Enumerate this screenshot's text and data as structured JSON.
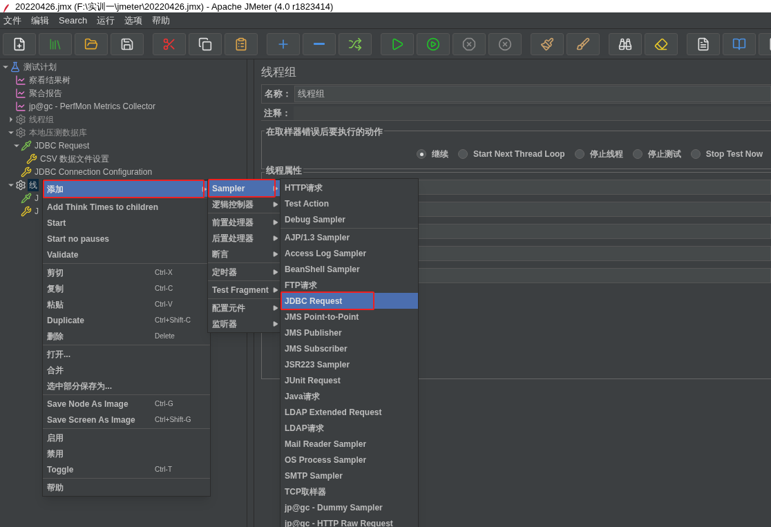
{
  "window": {
    "title": "20220426.jmx (F:\\实训一\\jmeter\\20220426.jmx) - Apache JMeter (4.0 r1823414)"
  },
  "menu_bar": [
    "文件",
    "编辑",
    "Search",
    "运行",
    "选项",
    "帮助"
  ],
  "toolbar": [
    [
      {
        "disabled": false
      },
      {
        "disabled": false
      },
      {
        "disabled": false
      },
      {
        "disabled": false
      }
    ],
    [
      {
        "disabled": false
      },
      {
        "disabled": false
      },
      {
        "disabled": false
      }
    ],
    [
      {
        "disabled": false
      },
      {
        "disabled": false
      },
      {
        "disabled": false
      }
    ],
    [
      {
        "disabled": false
      },
      {
        "disabled": false
      },
      {
        "disabled": true
      },
      {
        "disabled": true
      }
    ],
    [
      {
        "disabled": false
      },
      {
        "disabled": false
      }
    ],
    [
      {
        "disabled": false
      },
      {
        "disabled": false
      }
    ],
    [
      {
        "disabled": false
      },
      {
        "disabled": false
      },
      {
        "disabled": false
      }
    ]
  ],
  "tree": [
    {
      "label": "测试计划",
      "kind": "plan",
      "expanded": true,
      "selected": false,
      "disabled": false,
      "children": [
        {
          "label": "察看结果树",
          "kind": "listener",
          "selected": false,
          "disabled": false
        },
        {
          "label": "聚合报告",
          "kind": "listener",
          "selected": false,
          "disabled": false
        },
        {
          "label": "jp@gc - PerfMon Metrics Collector",
          "kind": "listener",
          "selected": false,
          "disabled": false
        },
        {
          "label": "线程组",
          "kind": "threadgroup",
          "expanded": false,
          "selected": false,
          "disabled": true
        },
        {
          "label": "本地压测数据库",
          "kind": "threadgroup",
          "expanded": true,
          "selected": false,
          "disabled": true,
          "children": [
            {
              "label": "JDBC Request",
              "kind": "sampler",
              "expanded": true,
              "selected": false,
              "disabled": false,
              "children": [
                {
                  "label": "CSV 数据文件设置",
                  "kind": "config",
                  "selected": false,
                  "disabled": false
                }
              ]
            },
            {
              "label": "JDBC Connection Configuration",
              "kind": "config",
              "selected": false,
              "disabled": false
            }
          ]
        },
        {
          "label": "线",
          "kind": "threadgroup",
          "expanded": true,
          "selected": true,
          "disabled": false,
          "children": [
            {
              "label": "J",
              "kind": "sampler",
              "selected": false,
              "disabled": false
            },
            {
              "label": "J",
              "kind": "config",
              "selected": false,
              "disabled": false
            }
          ]
        }
      ]
    }
  ],
  "panel": {
    "title": "线程组",
    "name_label": "名称：",
    "name_value": "线程组",
    "comment_label": "注释：",
    "error_action": {
      "title": "在取样器错误后要执行的动作",
      "options": [
        {
          "label": "继续",
          "selected": true
        },
        {
          "label": "Start Next Thread Loop",
          "selected": false
        },
        {
          "label": "停止线程",
          "selected": false
        },
        {
          "label": "停止测试",
          "selected": false
        },
        {
          "label": "Stop Test Now",
          "selected": false
        }
      ]
    },
    "thread_properties": {
      "title": "线程属性"
    }
  },
  "context_menu": [
    [
      {
        "label": "添加",
        "submenu": true,
        "selected": true,
        "highlighted": true
      }
    ],
    [
      {
        "label": "Add Think Times to children",
        "selected": false,
        "highlighted": false
      },
      {
        "label": "Start",
        "selected": false,
        "highlighted": false
      },
      {
        "label": "Start no pauses",
        "selected": false,
        "highlighted": false
      },
      {
        "label": "Validate",
        "selected": false,
        "highlighted": false
      }
    ],
    [
      {
        "label": "剪切",
        "shortcut": "Ctrl-X",
        "selected": false,
        "highlighted": false
      },
      {
        "label": "复制",
        "shortcut": "Ctrl-C",
        "selected": false,
        "highlighted": false
      },
      {
        "label": "粘贴",
        "shortcut": "Ctrl-V",
        "selected": false,
        "highlighted": false
      },
      {
        "label": "Duplicate",
        "shortcut": "Ctrl+Shift-C",
        "selected": false,
        "highlighted": false
      },
      {
        "label": "删除",
        "shortcut": "Delete",
        "selected": false,
        "highlighted": false
      }
    ],
    [
      {
        "label": "打开...",
        "selected": false,
        "highlighted": false
      },
      {
        "label": "合并",
        "selected": false,
        "highlighted": false
      },
      {
        "label": "选中部分保存为...",
        "selected": false,
        "highlighted": false
      }
    ],
    [
      {
        "label": "Save Node As Image",
        "shortcut": "Ctrl-G",
        "selected": false,
        "highlighted": false
      },
      {
        "label": "Save Screen As Image",
        "shortcut": "Ctrl+Shift-G",
        "selected": false,
        "highlighted": false
      }
    ],
    [
      {
        "label": "启用",
        "selected": false,
        "highlighted": false
      },
      {
        "label": "禁用",
        "selected": false,
        "highlighted": false
      },
      {
        "label": "Toggle",
        "shortcut": "Ctrl-T",
        "selected": false,
        "highlighted": false
      }
    ],
    [
      {
        "label": "帮助",
        "selected": false,
        "highlighted": false
      }
    ]
  ],
  "add_submenu": [
    [
      {
        "label": "Sampler",
        "submenu": true,
        "selected": true,
        "highlighted": true
      },
      {
        "label": "逻辑控制器",
        "submenu": true,
        "selected": false,
        "highlighted": false
      }
    ],
    [
      {
        "label": "前置处理器",
        "submenu": true,
        "selected": false,
        "highlighted": false
      },
      {
        "label": "后置处理器",
        "submenu": true,
        "selected": false,
        "highlighted": false
      },
      {
        "label": "断言",
        "submenu": true,
        "selected": false,
        "highlighted": false
      }
    ],
    [
      {
        "label": "定时器",
        "submenu": true,
        "selected": false,
        "highlighted": false
      }
    ],
    [
      {
        "label": "Test Fragment",
        "submenu": true,
        "selected": false,
        "highlighted": false
      }
    ],
    [
      {
        "label": "配置元件",
        "submenu": true,
        "selected": false,
        "highlighted": false
      },
      {
        "label": "监听器",
        "submenu": true,
        "selected": false,
        "highlighted": false
      }
    ]
  ],
  "sampler_submenu": [
    [
      {
        "label": "HTTP请求",
        "selected": false,
        "highlighted": false
      },
      {
        "label": "Test Action",
        "selected": false,
        "highlighted": false
      },
      {
        "label": "Debug Sampler",
        "selected": false,
        "highlighted": false
      }
    ],
    [
      {
        "label": "AJP/1.3 Sampler",
        "selected": false,
        "highlighted": false
      },
      {
        "label": "Access Log Sampler",
        "selected": false,
        "highlighted": false
      },
      {
        "label": "BeanShell Sampler",
        "selected": false,
        "highlighted": false
      },
      {
        "label": "FTP请求",
        "selected": false,
        "highlighted": false
      },
      {
        "label": "JDBC Request",
        "selected": true,
        "highlighted": true
      },
      {
        "label": "JMS Point-to-Point",
        "selected": false,
        "highlighted": false
      },
      {
        "label": "JMS Publisher",
        "selected": false,
        "highlighted": false
      },
      {
        "label": "JMS Subscriber",
        "selected": false,
        "highlighted": false
      },
      {
        "label": "JSR223 Sampler",
        "selected": false,
        "highlighted": false
      },
      {
        "label": "JUnit Request",
        "selected": false,
        "highlighted": false
      },
      {
        "label": "Java请求",
        "selected": false,
        "highlighted": false
      },
      {
        "label": "LDAP Extended Request",
        "selected": false,
        "highlighted": false
      },
      {
        "label": "LDAP请求",
        "selected": false,
        "highlighted": false
      },
      {
        "label": "Mail Reader Sampler",
        "selected": false,
        "highlighted": false
      },
      {
        "label": "OS Process Sampler",
        "selected": false,
        "highlighted": false
      },
      {
        "label": "SMTP Sampler",
        "selected": false,
        "highlighted": false
      },
      {
        "label": "TCP取样器",
        "selected": false,
        "highlighted": false
      },
      {
        "label": "jp@gc - Dummy Sampler",
        "selected": false,
        "highlighted": false
      },
      {
        "label": "jp@gc - HTTP Raw Request",
        "selected": false,
        "highlighted": false
      }
    ]
  ]
}
